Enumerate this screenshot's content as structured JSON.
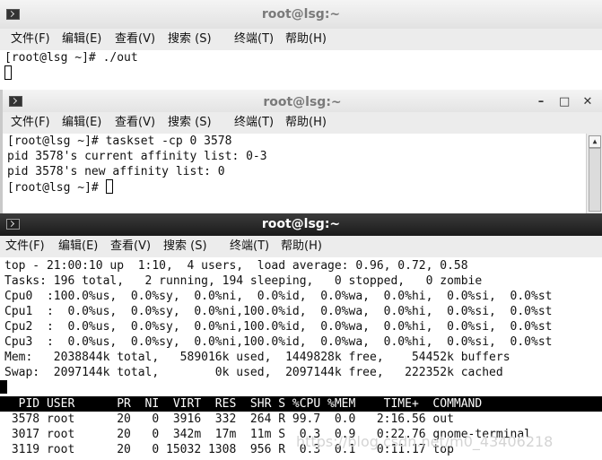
{
  "menu_items": [
    "文件(F)",
    "编辑(E)",
    "查看(V)",
    "搜索 (S)",
    "终端(T)",
    "帮助(H)"
  ],
  "window1": {
    "title": "root@lsg:~",
    "lines": [
      "[root@lsg ~]# ./out"
    ]
  },
  "window2": {
    "title": "root@lsg:~",
    "controls": [
      "–",
      "□",
      "✕"
    ],
    "lines": [
      "[root@lsg ~]# taskset -cp 0 3578",
      "pid 3578's current affinity list: 0-3",
      "pid 3578's new affinity list: 0",
      "[root@lsg ~]# "
    ]
  },
  "window3": {
    "title": "root@lsg:~",
    "summary": [
      "top - 21:00:10 up  1:10,  4 users,  load average: 0.96, 0.72, 0.58",
      "Tasks: 196 total,   2 running, 194 sleeping,   0 stopped,   0 zombie",
      "Cpu0  :100.0%us,  0.0%sy,  0.0%ni,  0.0%id,  0.0%wa,  0.0%hi,  0.0%si,  0.0%st",
      "Cpu1  :  0.0%us,  0.0%sy,  0.0%ni,100.0%id,  0.0%wa,  0.0%hi,  0.0%si,  0.0%st",
      "Cpu2  :  0.0%us,  0.0%sy,  0.0%ni,100.0%id,  0.0%wa,  0.0%hi,  0.0%si,  0.0%st",
      "Cpu3  :  0.0%us,  0.0%sy,  0.0%ni,100.0%id,  0.0%wa,  0.0%hi,  0.0%si,  0.0%st",
      "Mem:   2038844k total,   589016k used,  1449828k free,    54452k buffers",
      "Swap:  2097144k total,        0k used,  2097144k free,   222352k cached"
    ],
    "header": "  PID USER      PR  NI  VIRT  RES  SHR S %CPU %MEM    TIME+  COMMAND",
    "processes": [
      " 3578 root      20   0  3916  332  264 R 99.7  0.0   2:16.56 out",
      " 3017 root      20   0  342m  17m  11m S  0.3  0.9   0:22.76 gnome-terminal",
      " 3119 root      20   0 15032 1308  956 R  0.3  0.1   0:11.17 top"
    ]
  },
  "watermark": "https://blog.csdn.net/m0_43406218"
}
